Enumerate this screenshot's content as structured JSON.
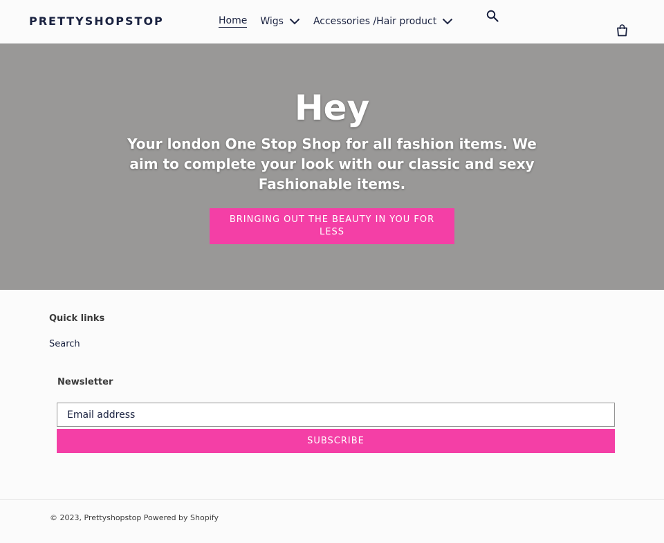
{
  "header": {
    "logo": "PRETTYSHOPSTOP",
    "nav": [
      {
        "label": "Home",
        "active": true
      },
      {
        "label": "Wigs",
        "dropdown": true
      },
      {
        "label": "Accessories /Hair product",
        "dropdown": true
      }
    ],
    "icons": {
      "search": "search-icon",
      "cart": "cart-icon",
      "chevron": "chevron-down-icon"
    }
  },
  "hero": {
    "title": "Hey",
    "subtitle": "Your london One Stop Shop for all fashion  items. We\naim to complete your look with our classic and sexy\nFashionable items.",
    "button_label": "BRINGING OUT THE BEAUTY IN YOU FOR LESS"
  },
  "footer": {
    "quick_links_title": "Quick links",
    "quick_links": [
      "Search"
    ],
    "newsletter_title": "Newsletter",
    "email_placeholder": "Email address",
    "subscribe_label": "SUBSCRIBE",
    "copyright_prefix": "© 2023,",
    "shop_name": "Prettyshopstop",
    "powered_by": "Powered by Shopify"
  },
  "colors": {
    "accent": "#f43fa6",
    "hero_bg": "#999897",
    "text": "#1a2240",
    "page_bg": "#fbfbfb"
  }
}
